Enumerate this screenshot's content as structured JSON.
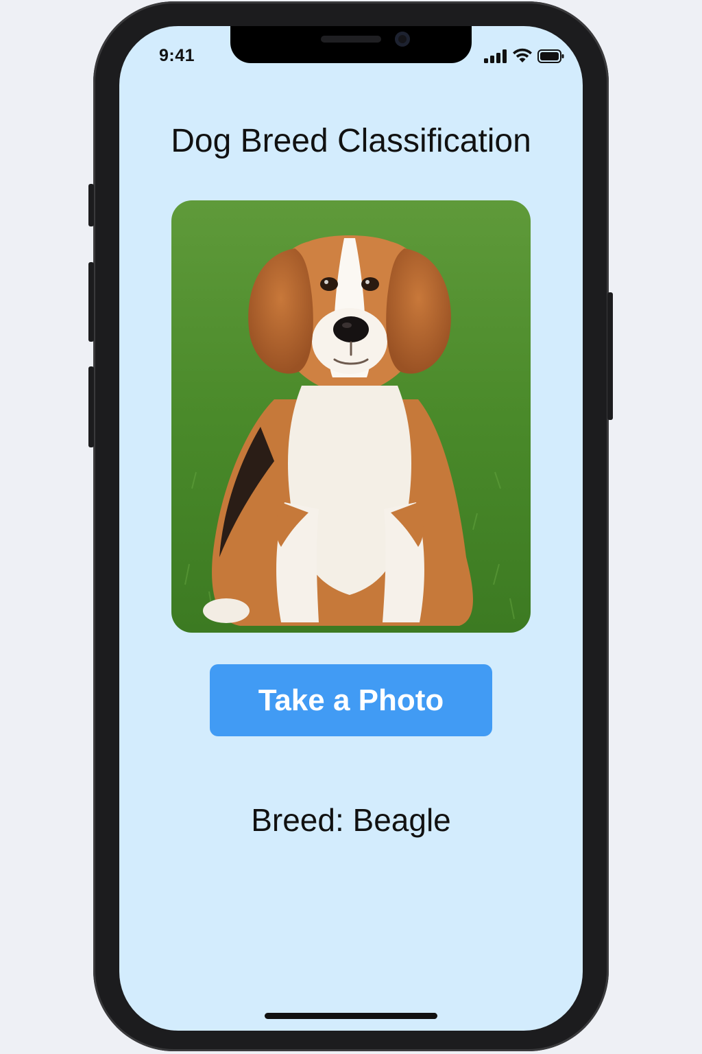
{
  "status_bar": {
    "time": "9:41",
    "signal_icon": "cellular-signal-icon",
    "wifi_icon": "wifi-icon",
    "battery_icon": "battery-icon"
  },
  "screen": {
    "title": "Dog Breed Classification",
    "photo": {
      "subject": "beagle-photo"
    },
    "take_photo_button": "Take a Photo",
    "result_text": "Breed: Beagle"
  },
  "colors": {
    "screen_background": "#d3ecfd",
    "button_background": "#419bf4",
    "button_text": "#ffffff",
    "text": "#111111"
  }
}
